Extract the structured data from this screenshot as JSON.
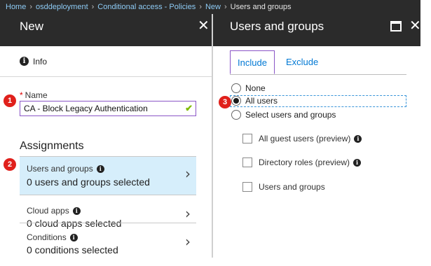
{
  "breadcrumb": [
    "Home",
    "osddeployment",
    "Conditional access - Policies",
    "New",
    "Users and groups"
  ],
  "left_panel": {
    "title": "New",
    "close": "✕",
    "info_label": "Info",
    "name": {
      "label": "Name",
      "required": "*",
      "value": "CA - Block Legacy Authentication",
      "valid_icon": "check-icon"
    },
    "assignments_title": "Assignments",
    "items": [
      {
        "title": "Users and groups",
        "subtitle": "0 users and groups selected"
      },
      {
        "title": "Cloud apps",
        "subtitle": "0 cloud apps selected"
      },
      {
        "title": "Conditions",
        "subtitle": "0 conditions selected"
      }
    ],
    "chevron": "›"
  },
  "right_panel": {
    "title": "Users and groups",
    "close": "✕",
    "tabs": [
      "Include",
      "Exclude"
    ],
    "active_tab": "Include",
    "radio_options": [
      "None",
      "All users",
      "Select users and groups"
    ],
    "selected_option": "All users",
    "checkboxes": [
      {
        "label": "All guest users (preview)",
        "checked": false,
        "info": true
      },
      {
        "label": "Directory roles (preview)",
        "checked": false,
        "info": true
      },
      {
        "label": "Users and groups",
        "checked": false,
        "info": false
      }
    ]
  },
  "annotations": [
    "1",
    "2",
    "3"
  ],
  "colors": {
    "header_bg": "#2b2b2b",
    "link": "#8ecbf5",
    "accent": "#0078d4",
    "focus_border": "#8a55c7",
    "badge": "#e0201b",
    "selected_item_bg": "#d6eefb",
    "valid": "#7fba00"
  }
}
